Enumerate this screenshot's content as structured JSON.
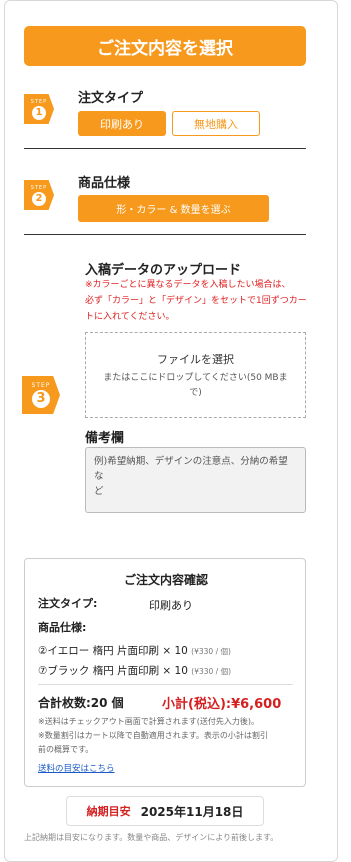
{
  "header": {
    "title": "ご注文内容を選択"
  },
  "steps": {
    "step_word": "STEP",
    "s1": {
      "num": "1",
      "title": "注文タイプ",
      "opt_print": "印刷あり",
      "opt_plain": "無地購入"
    },
    "s2": {
      "num": "2",
      "title": "商品仕様",
      "choose_label": "形・カラー & 数量を選ぶ"
    },
    "s3": {
      "num": "3",
      "upload_title": "入稿データのアップロード",
      "note_lines": [
        "※カラーごとに異なるデータを入稿したい場合は、",
        "必ず「カラー」と「デザイン」をセットで1回ずつカー",
        "トに入れてください。"
      ],
      "file_select": "ファイルを選択",
      "drop_lines": [
        "またはここにドロップしてください(50 MBま",
        "で)"
      ],
      "remarks_title": "備考欄",
      "remarks_placeholder_lines": [
        "例)希望納期、デザインの注意点、分納の希望な",
        "ど"
      ]
    }
  },
  "summary": {
    "title": "ご注文内容確認",
    "order_type_label": "注文タイプ:",
    "order_type_value": "印刷あり",
    "spec_label": "商品仕様:",
    "items": [
      {
        "text": "②イエロー 楕円 片面印刷 × 10",
        "price": "(¥330 / 個)"
      },
      {
        "text": "⑦ブラック 楕円 片面印刷 × 10",
        "price": "(¥330 / 個)"
      }
    ],
    "total_count": "合計枚数:20 個",
    "subtotal": "小計(税込):¥6,600",
    "notes": [
      "※送料はチェックアウト画面で計算されます(送付先入力後)。",
      "※数量割引はカート以降で自動適用されます。表示の小計は割引",
      "前の概算です。"
    ],
    "shipping_link": "送料の目安はこちら"
  },
  "delivery": {
    "label": "納期目安",
    "date": "2025年11月18日"
  },
  "footer_note": "上記納期は目安になります。数量や商品、デザインにより前後します。",
  "colors": {
    "accent": "#f7991c",
    "red": "#d42020"
  }
}
